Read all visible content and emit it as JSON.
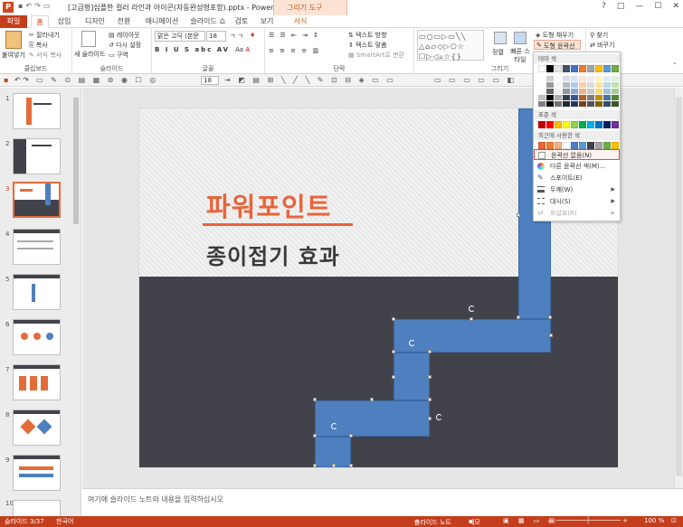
{
  "titlebar": {
    "app_icon": "P",
    "title": "[고급형]심플한 컬러 라인과 아이콘(자동완성형포함).pptx - PowerPoint",
    "context_tab": "그리기 도구",
    "help": "?",
    "win_buttons": [
      "□",
      "—",
      "☐",
      "✕"
    ]
  },
  "tabs": {
    "file": "파일",
    "home": "홈",
    "insert": "삽입",
    "design": "디자인",
    "transitions": "전환",
    "animations": "애니메이션",
    "slideshow": "슬라이드 쇼",
    "review": "검토",
    "view": "보기",
    "format": "서식"
  },
  "ribbon": {
    "clipboard": {
      "paste": "붙여넣기",
      "cut": "잘라내기",
      "copy": "복사",
      "format_painter": "서식 복사",
      "group": "클립보드"
    },
    "slides": {
      "new_slide": "새 슬라이드",
      "layout": "레이아웃",
      "reset": "다시 설정",
      "section": "구역",
      "group": "슬라이드"
    },
    "font": {
      "family": "맑은 고딕 (본문",
      "size": "18",
      "group": "글꼴"
    },
    "paragraph": {
      "text_direction": "텍스트 방향",
      "align_text": "텍스트 맞춤",
      "smartart": "SmartArt로 변환",
      "group": "단락"
    },
    "drawing": {
      "arrange": "정렬",
      "quick_styles": "빠른 스타일",
      "shape_fill": "도형 채우기",
      "shape_outline": "도형 윤곽선",
      "group": "그리기"
    },
    "editing": {
      "find": "찾기",
      "replace": "바꾸기"
    }
  },
  "format_bar": {
    "font_size": "18"
  },
  "thumbnails": [
    {
      "num": "1",
      "selected": false
    },
    {
      "num": "2",
      "selected": false
    },
    {
      "num": "3",
      "selected": true
    },
    {
      "num": "4",
      "selected": false
    },
    {
      "num": "5",
      "selected": false
    },
    {
      "num": "6",
      "selected": false
    },
    {
      "num": "7",
      "selected": false
    },
    {
      "num": "8",
      "selected": false
    },
    {
      "num": "9",
      "selected": false
    },
    {
      "num": "10",
      "selected": false
    }
  ],
  "slide": {
    "title": "파워포인트",
    "subtitle": "종이접기 효과",
    "top_color": "#ececec",
    "bottom_color": "#42434a",
    "accent_color": "#e8643a",
    "shape_color": "#4e7fbe"
  },
  "notes": {
    "placeholder": "여기에 슬라이드 노트의 내용을 입력하십시오"
  },
  "status": {
    "slide_info": "슬라이드 3/37",
    "language": "한국어",
    "notes": "슬라이드 노트",
    "comments": "메모",
    "zoom": "100 %"
  },
  "dropdown": {
    "theme_colors": "테마 색",
    "standard_colors": "표준 색",
    "recent_colors": "최근에 사용한 색",
    "no_outline": "윤곽선 없음(N)",
    "more_colors": "다른 윤곽선 색(M)...",
    "eyedropper": "스포이트(E)",
    "weight": "두께(W)",
    "dashes": "대시(S)",
    "arrows": "화살표(R)",
    "theme_row": [
      "#ffffff",
      "#000000",
      "#e7e6e6",
      "#44546a",
      "#4472c4",
      "#ed7d31",
      "#a5a5a5",
      "#ffc000",
      "#5b9bd5",
      "#70ad47"
    ],
    "standard_row": [
      "#c00000",
      "#ff0000",
      "#ffc000",
      "#ffff00",
      "#92d050",
      "#00b050",
      "#00b0f0",
      "#0070c0",
      "#002060",
      "#7030a0"
    ],
    "recent_row": [
      "#e8643a",
      "#ed7d31",
      "#f4b183",
      "#ffffff",
      "#4e7fbe",
      "#5b9bd5",
      "#42434a",
      "#a5a5a5",
      "#70ad47",
      "#ffc000"
    ]
  }
}
